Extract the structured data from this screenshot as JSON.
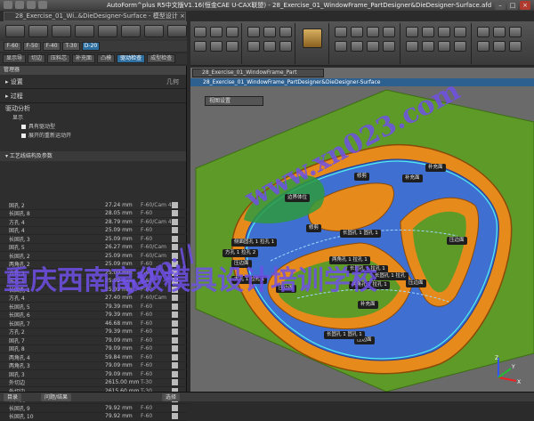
{
  "window": {
    "title": "AutoForm^plus R5中文版V1.16(恒金CAE U-CAX联盟) - 28_Exercise_01_WindowFrame_PartDesigner&DieDesigner-Surface.afd",
    "minimize": "–",
    "maximize": "□",
    "close": "×"
  },
  "doc_tab": "28_Exercise_01_Wi..&DieDesigner-Surface - 模型设计 ×",
  "steps": [
    "F-60",
    "F-50",
    "F-40",
    "T-30",
    "D-20"
  ],
  "actions": [
    "显示导",
    "切边",
    "压料芯",
    "补充面",
    "凸模",
    "驱动检查",
    "成型检查"
  ],
  "panel": {
    "header": "管理器",
    "sec_settings": "设置",
    "sec_settings_right": "几何",
    "sec_process": "过程",
    "sec_drive": "驱动分析",
    "display_label": "显示",
    "opt1": "具有驱动型",
    "opt2": "展开的重新运动开",
    "list_title": "工艺线结构及参数"
  },
  "rows": [
    {
      "name": "固孔 2",
      "val": "27.24 mm",
      "stage": "F-60/Cam 4"
    },
    {
      "name": "长固孔 8",
      "val": "28.05 mm",
      "stage": "F-60"
    },
    {
      "name": "方孔 4",
      "val": "28.79 mm",
      "stage": "F-60/Cam 4"
    },
    {
      "name": "固孔 4",
      "val": "25.09 mm",
      "stage": "F-60"
    },
    {
      "name": "长固孔 3",
      "val": "25.09 mm",
      "stage": "F-60"
    },
    {
      "name": "固孔 5",
      "val": "26.27 mm",
      "stage": "F-60/Cam"
    },
    {
      "name": "长固孔 2",
      "val": "25.09 mm",
      "stage": "F-60/Cam"
    },
    {
      "name": "两角孔 2",
      "val": "25.09 mm",
      "stage": "F-60"
    },
    {
      "name": "方孔 3",
      "val": "25.09 mm",
      "stage": "F-60"
    },
    {
      "name": "方孔 1",
      "val": "25.09 mm",
      "stage": "F-60"
    },
    {
      "name": "长固孔 1",
      "val": "25.09 mm",
      "stage": "F-60"
    },
    {
      "name": "方孔 4",
      "val": "27.40 mm",
      "stage": "F-60/Cam"
    },
    {
      "name": "长固孔 5",
      "val": "79.39 mm",
      "stage": "F-60"
    },
    {
      "name": "长固孔 6",
      "val": "79.39 mm",
      "stage": "F-60"
    },
    {
      "name": "长固孔 7",
      "val": "46.68 mm",
      "stage": "F-60"
    },
    {
      "name": "方孔 2",
      "val": "79.39 mm",
      "stage": "F-60"
    },
    {
      "name": "固孔 7",
      "val": "79.09 mm",
      "stage": "F-60"
    },
    {
      "name": "固孔 8",
      "val": "79.09 mm",
      "stage": "F-60"
    },
    {
      "name": "两角孔 4",
      "val": "59.84 mm",
      "stage": "F-60"
    },
    {
      "name": "两角孔 3",
      "val": "79.09 mm",
      "stage": "F-60"
    },
    {
      "name": "固孔 3",
      "val": "79.09 mm",
      "stage": "F-60"
    },
    {
      "name": "外切边",
      "val": "2615.00 mm",
      "stage": "T-30"
    },
    {
      "name": "外切边",
      "val": "2615.60 mm",
      "stage": "T-30"
    },
    {
      "name": "长固孔 4",
      "val": "79.92 mm",
      "stage": "F-60"
    },
    {
      "name": "长固孔 9",
      "val": "79.92 mm",
      "stage": "F-60"
    },
    {
      "name": "长固孔 10",
      "val": "79.92 mm",
      "stage": "F-60"
    }
  ],
  "bottom": {
    "b1": "目录",
    "b2": "问题/结果",
    "b3": "选择"
  },
  "viewport": {
    "tab": "28_Exercise_01_WindowFrame_Part",
    "title": "28_Exercise_01_WindowFrame_PartDesigner&DieDesigner-Surface",
    "display": "视图设置"
  },
  "labels": {
    "l1": "边界体位",
    "l2": "修剪",
    "l3": "补充面",
    "l4": "补充面",
    "l5": "修剪",
    "l6": "侧面固孔 1 拉孔 1",
    "l7": "长固孔 1 固孔 1",
    "l8": "压边面",
    "l9": "方孔 1 拉孔 2",
    "l10": "两角孔 1 拉孔 1",
    "l11": "压边面",
    "l12": "长固孔 1 拉孔 1",
    "l13": "长固孔 1 拉孔",
    "l14": "压边面",
    "l15": "压边面",
    "l16": "大孔 1 拉孔 1",
    "l17": "两角孔 1 拉孔 1",
    "l18": "补充面",
    "l19": "压边面",
    "l20": "长固孔 1 固孔 1"
  },
  "watermark": {
    "w1": "重庆西南高级模具设计培训学校",
    "w2": "www.xn023.com",
    "w3": "http://"
  },
  "axes": {
    "x": "X",
    "y": "Y",
    "z": "Z"
  }
}
